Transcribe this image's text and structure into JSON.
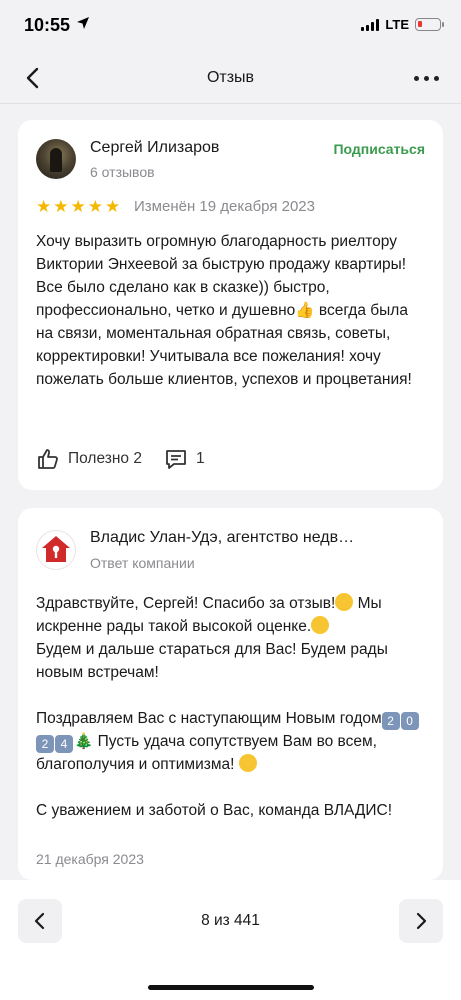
{
  "status": {
    "time": "10:55",
    "network": "LTE",
    "icons": [
      "location-arrow-icon",
      "signal-icon",
      "battery-low-icon"
    ]
  },
  "nav": {
    "title": "Отзыв",
    "icons": [
      "back-chevron-icon",
      "more-dots-icon"
    ]
  },
  "review": {
    "author": "Сергей Илизаров",
    "reviews_count": "6 отзывов",
    "subscribe_label": "Подписаться",
    "rating": 5,
    "edited": "Изменён 19 декабря 2023",
    "text_part1": "Хочу выразить огромную благодарность риелтору Виктории Энхеевой за быструю продажу квартиры! Все было сделано как в сказке)) быстро, профессионально, четко и душевно",
    "text_part2": " всегда была на связи, моментальная обратная связь, советы, корректировки! Учитывала все пожелания! хочу пожелать больше клиентов, успехов и процветания!",
    "useful_label": "Полезно 2",
    "comments_count": "1",
    "accent_color": "#3a9b4e",
    "star_color": "#f5b800"
  },
  "reply": {
    "company": "Владис Улан-Удэ, агентство недв…",
    "company_sub": "Ответ компании",
    "p1a": "Здравствуйте, Сергей! Спасибо за отзыв!",
    "p1b": " Мы искренне рады такой высокой оценке.",
    "p1c": "Будем и дальше стараться для Вас! Будем рады новым встречам!",
    "p2a": "Поздравляем Вас с наступающим Новым годом",
    "year_digits": [
      "2",
      "0",
      "2",
      "4"
    ],
    "p2b": " Пусть удача сопутствуем Вам во всем, благополучия и оптимизма! ",
    "p3": "С уважением и заботой о Вас, команда ВЛАДИС!",
    "date": "21 декабря 2023"
  },
  "pager": {
    "text": "8 из 441",
    "icons": [
      "prev-chevron-icon",
      "next-chevron-icon"
    ]
  }
}
